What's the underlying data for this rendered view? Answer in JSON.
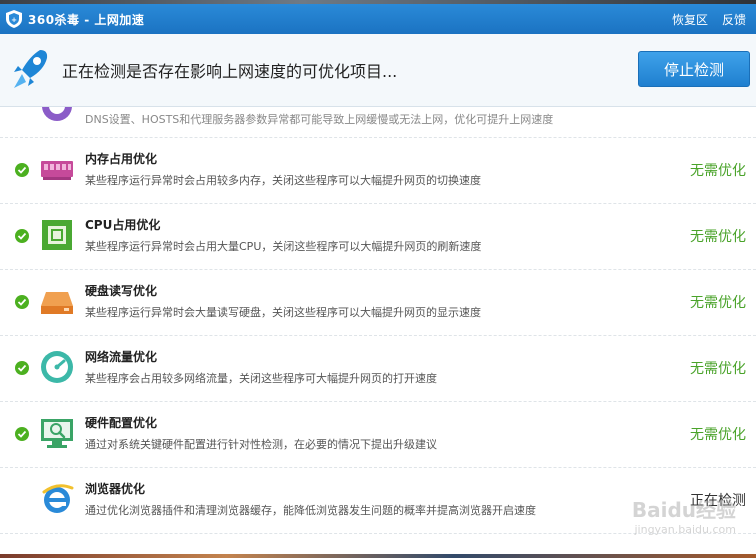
{
  "titlebar": {
    "title": "360杀毒 - 上网加速",
    "actions": [
      "恢复区",
      "反馈"
    ]
  },
  "header": {
    "message": "正在检测是否存在影响上网速度的可优化项目...",
    "stop_button": "停止检测"
  },
  "partial_item": {
    "desc": "DNS设置、HOSTS和代理服务器参数异常都可能导致上网缓慢或无法上网，优化可提升上网速度",
    "icon": "dns-icon"
  },
  "items": [
    {
      "title": "内存占用优化",
      "desc": "某些程序运行异常时会占用较多内存，关闭这些程序可以大幅提升网页的切换速度",
      "status": "无需优化",
      "icon": "memory-icon"
    },
    {
      "title": "CPU占用优化",
      "desc": "某些程序运行异常时会占用大量CPU，关闭这些程序可以大幅提升网页的刷新速度",
      "status": "无需优化",
      "icon": "cpu-icon"
    },
    {
      "title": "硬盘读写优化",
      "desc": "某些程序运行异常时会大量读写硬盘，关闭这些程序可以大幅提升网页的显示速度",
      "status": "无需优化",
      "icon": "harddisk-icon"
    },
    {
      "title": "网络流量优化",
      "desc": "某些程序会占用较多网络流量，关闭这些程序可大幅提升网页的打开速度",
      "status": "无需优化",
      "icon": "network-speed-icon"
    },
    {
      "title": "硬件配置优化",
      "desc": "通过对系统关键硬件配置进行针对性检测，在必要的情况下提出升级建议",
      "status": "无需优化",
      "icon": "hardware-monitor-icon"
    },
    {
      "title": "浏览器优化",
      "desc": "通过优化浏览器插件和清理浏览器缓存，能降低浏览器发生问题的概率并提高浏览器开启速度",
      "status": "正在检测",
      "icon": "ie-browser-icon"
    }
  ],
  "watermark": {
    "main": "Baidu经验",
    "sub": "jingyan.baidu.com"
  },
  "colors": {
    "titlebar": "#1b73c2",
    "ok_status": "#4aa32a",
    "check": "#4cb020",
    "button": "#2a8ad8"
  }
}
